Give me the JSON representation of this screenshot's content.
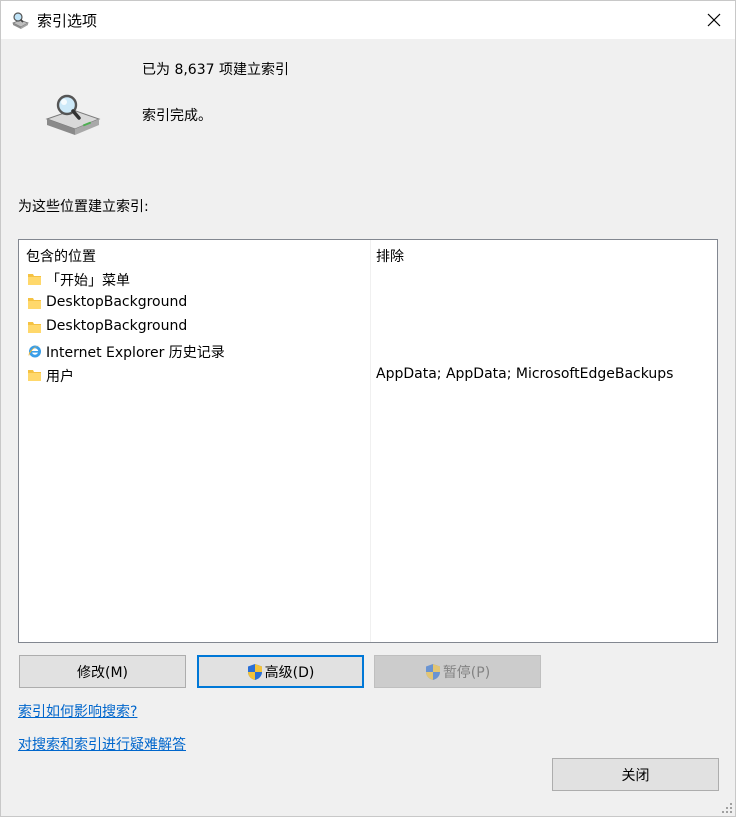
{
  "window": {
    "title": "索引选项",
    "close_glyph": "✕"
  },
  "status": {
    "line1": "已为 8,637 项建立索引",
    "line2": "索引完成。"
  },
  "section_label": "为这些位置建立索引:",
  "table": {
    "col_included": "包含的位置",
    "col_excluded": "排除",
    "rows": [
      {
        "name": "「开始」菜单",
        "icon": "folder-icon",
        "excluded": ""
      },
      {
        "name": "DesktopBackground",
        "icon": "folder-icon",
        "excluded": ""
      },
      {
        "name": "DesktopBackground",
        "icon": "folder-icon",
        "excluded": ""
      },
      {
        "name": "Internet Explorer 历史记录",
        "icon": "ie-icon",
        "excluded": ""
      },
      {
        "name": "用户",
        "icon": "folder-icon",
        "excluded": "AppData; AppData; MicrosoftEdgeBackups"
      }
    ]
  },
  "buttons": {
    "modify": "修改(M)",
    "advanced": "高级(D)",
    "pause": "暂停(P)",
    "close": "关闭"
  },
  "links": {
    "how_affects": "索引如何影响搜索?",
    "troubleshoot": "对搜索和索引进行疑难解答"
  },
  "colors": {
    "link": "#0066cc",
    "accent": "#0078d7",
    "folder": "#f5c242"
  }
}
